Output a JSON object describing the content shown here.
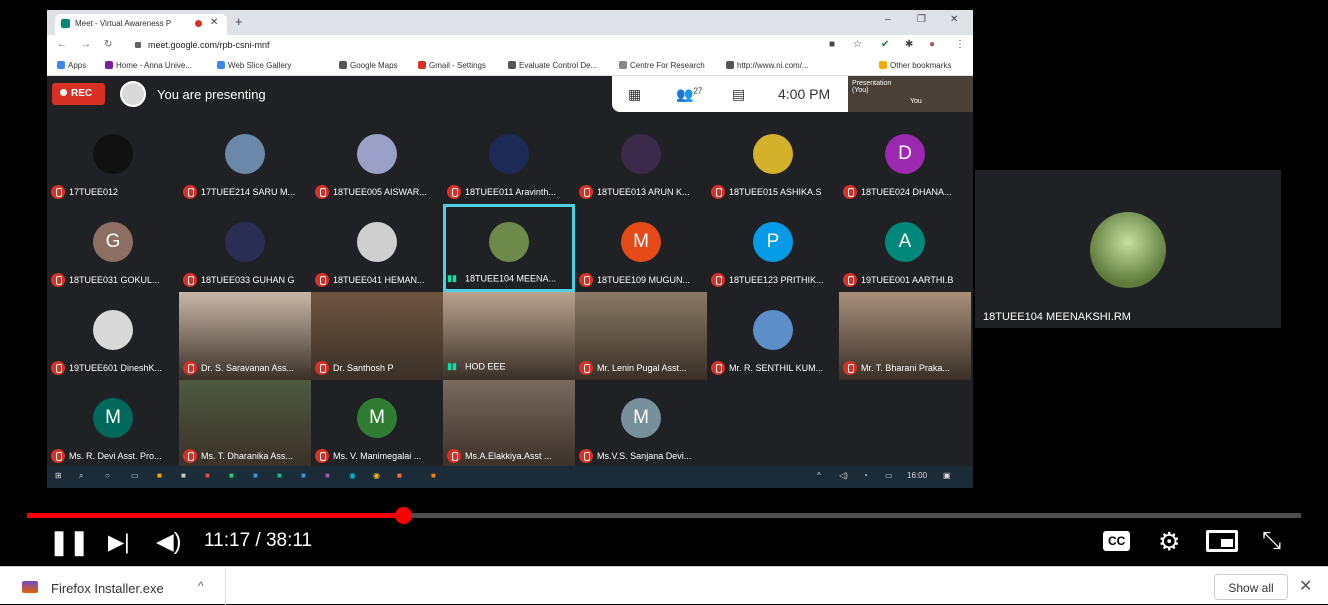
{
  "browser": {
    "tab_title": "Meet - Virtual Awareness P",
    "url": "meet.google.com/rpb-csni-mnf",
    "bookmarks": [
      "Apps",
      "Home - Anna Unive...",
      "Web Slice Gallery",
      "Google Maps",
      "Gmail - Settings",
      "Evaluate Control De...",
      "Centre For Research",
      "http://www.ni.com/...",
      "Other bookmarks"
    ]
  },
  "meet": {
    "rec_label": "REC",
    "presenting_label": "You are presenting",
    "participant_count": "27",
    "time": "4:00 PM",
    "presentation_thumb": "Presentation (You)",
    "presentation_you": "You",
    "tiles": [
      {
        "name": "17TUEE012",
        "color": "#111111",
        "letter": "",
        "row": 0,
        "col": 0
      },
      {
        "name": "17TUEE214 SARU M...",
        "color": "#6b88a8",
        "letter": "",
        "row": 0,
        "col": 1
      },
      {
        "name": "18TUEE005 AISWAR...",
        "color": "#9aa0c8",
        "letter": "",
        "row": 0,
        "col": 2
      },
      {
        "name": "18TUEE011 Aravinth...",
        "color": "#1c2a55",
        "letter": "",
        "row": 0,
        "col": 3
      },
      {
        "name": "18TUEE013 ARUN K...",
        "color": "#3b2a4a",
        "letter": "",
        "row": 0,
        "col": 4
      },
      {
        "name": "18TUEE015 ASHIKA.S",
        "color": "#d4b12a",
        "letter": "",
        "row": 0,
        "col": 5
      },
      {
        "name": "18TUEE024 DHANA...",
        "color": "#9c27b0",
        "letter": "D",
        "row": 0,
        "col": 6
      },
      {
        "name": "18TUEE031 GOKUL...",
        "color": "#8d6e63",
        "letter": "G",
        "row": 1,
        "col": 0
      },
      {
        "name": "18TUEE033 GUHAN G",
        "color": "#2a2e55",
        "letter": "",
        "row": 1,
        "col": 1
      },
      {
        "name": "18TUEE041 HEMAN...",
        "color": "#cfcfcf",
        "letter": "",
        "row": 1,
        "col": 2
      },
      {
        "name": "18TUEE104 MEENA...",
        "color": "#6d8a4a",
        "letter": "",
        "row": 1,
        "col": 3,
        "active": true
      },
      {
        "name": "18TUEE109 MUGUN...",
        "color": "#e64a19",
        "letter": "M",
        "row": 1,
        "col": 4
      },
      {
        "name": "18TUEE123 PRITHIK...",
        "color": "#039be5",
        "letter": "P",
        "row": 1,
        "col": 5
      },
      {
        "name": "19TUEE001 AARTHI.B",
        "color": "#00897b",
        "letter": "A",
        "row": 1,
        "col": 6
      },
      {
        "name": "19TUEE601 DineshK...",
        "color": "#d9d9d9",
        "letter": "",
        "row": 2,
        "col": 0
      },
      {
        "name": "Dr. S. Saravanan Ass...",
        "color": "#c9b8a8",
        "letter": "",
        "row": 2,
        "col": 1,
        "video": true
      },
      {
        "name": "Dr. Santhosh P",
        "color": "#6e5540",
        "letter": "",
        "row": 2,
        "col": 2,
        "video": true
      },
      {
        "name": "HOD EEE",
        "color": "#b9a38f",
        "letter": "",
        "row": 2,
        "col": 3,
        "video": true
      },
      {
        "name": "Mr. Lenin Pugal Asst...",
        "color": "#8a7a66",
        "letter": "",
        "row": 2,
        "col": 4,
        "video": true
      },
      {
        "name": "Mr. R. SENTHIL KUM...",
        "color": "#5c8fc9",
        "letter": "",
        "row": 2,
        "col": 5
      },
      {
        "name": "Mr. T. Bharani Praka...",
        "color": "#a8907a",
        "letter": "",
        "row": 2,
        "col": 6,
        "video": true
      },
      {
        "name": "Ms. R. Devi Asst. Pro...",
        "color": "#00695c",
        "letter": "M",
        "row": 3,
        "col": 0
      },
      {
        "name": "Ms. T. Dharanika Ass...",
        "color": "#4e5a40",
        "letter": "",
        "row": 3,
        "col": 1,
        "video": true
      },
      {
        "name": "Ms. V. Manimegalai ...",
        "color": "#2e7d32",
        "letter": "M",
        "row": 3,
        "col": 2
      },
      {
        "name": "Ms.A.Elakkiya.Asst ...",
        "color": "#7a6a60",
        "letter": "",
        "row": 3,
        "col": 3,
        "video": true
      },
      {
        "name": "Ms.V.S. Sanjana Devi...",
        "color": "#78909c",
        "letter": "M",
        "row": 3,
        "col": 4
      }
    ],
    "taskbar_time": "16:00",
    "spotlight_name": "18TUEE104 MEENAKSHI.RM"
  },
  "player": {
    "progress": 0.295,
    "time_display": "11:17 / 38:11"
  },
  "downloads": {
    "file_name": "Firefox Installer.exe",
    "show_all": "Show all"
  }
}
